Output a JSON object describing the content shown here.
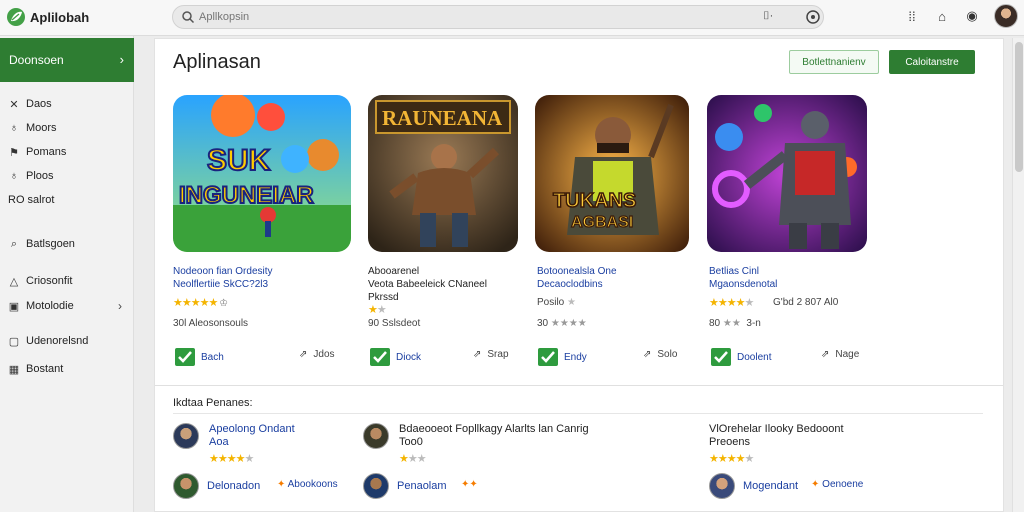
{
  "app": {
    "name": "Aplilobah"
  },
  "search": {
    "placeholder": "Apllkopsin"
  },
  "sidebar": {
    "active": "Doonsoen",
    "items": [
      {
        "label": "Daos",
        "icon": "x-icon"
      },
      {
        "label": "Moors",
        "icon": "pin-icon"
      },
      {
        "label": "Pomans",
        "icon": "flag-icon"
      },
      {
        "label": "Ploos",
        "icon": "pin-icon"
      },
      {
        "label": "RO salrot",
        "icon": ""
      },
      {
        "label": "Batlsgoen",
        "icon": "search-icon"
      },
      {
        "label": "Criosonfit",
        "icon": "triangle-icon"
      },
      {
        "label": "Motolodie",
        "icon": "box-icon"
      },
      {
        "label": "Udenorelsnd",
        "icon": "square-icon"
      },
      {
        "label": "Bostant",
        "icon": "grid-icon"
      }
    ]
  },
  "main": {
    "title": "Aplinasan",
    "btn_outline": "Botlettnanienv",
    "btn_solid": "Caloitanstre"
  },
  "cards": [
    {
      "thumb_text_1": "SUK",
      "thumb_text_2": "INGUNEIAR",
      "title_1": "Nodeoon fian Ordesity",
      "title_2": "Neolflertiie SkCC?2l3",
      "stars": 4.5,
      "meta": "30l Aleosonsouls",
      "action_a": "Bach",
      "action_b": "Jdos"
    },
    {
      "thumb_text_1": "RAUNEANA",
      "thumb_text_2": "",
      "title_1": "Abooarenel",
      "title_2": "Veota Babeeleick CNaneel",
      "title_3": "Pkrssd",
      "stars": 2,
      "meta": "90 Sslsdeot",
      "action_a": "Diock",
      "action_b": "Srap"
    },
    {
      "thumb_text_1": "TUKANS",
      "thumb_text_2": "AGBASI",
      "title_1": "Botoonealsla One",
      "title_2": "Decaoclodbins",
      "title_3": "Posilo",
      "stars": 0,
      "meta": "30",
      "meta_stars": 3,
      "action_a": "Endy",
      "action_b": "Solo"
    },
    {
      "thumb_text_1": "",
      "thumb_text_2": "",
      "title_1": "Betlias Cinl",
      "title_2": "Mgaonsdenotal",
      "stars": 4,
      "meta_right": "G'bd 2 807 Al0",
      "meta": "80",
      "meta_stars": 2,
      "meta_suffix": "3-n",
      "action_a": "Doolent",
      "action_b": "Nage"
    }
  ],
  "reviews": {
    "section_title": "Ikdtaa Penanes:",
    "rows": [
      {
        "name": "Apeolong Ondant",
        "sub": "Aoa",
        "stars": 4
      },
      {
        "name": "Bdaeooeot Fopllkagy Alarlts lan Canrig",
        "sub": "Too0",
        "stars": 1
      },
      {
        "name": "VlOrehelar Ilooky Bedooont",
        "sub": "Preoens",
        "stars": 4
      },
      {
        "name": "Delonadon",
        "tag": "Abookoons"
      },
      {
        "name": "Penaolam",
        "tag": ""
      },
      {
        "name": "Mogendant",
        "tag": "Oenoene"
      }
    ]
  },
  "colors": {
    "brand_green": "#2e7d32",
    "link_blue": "#1a3ea0",
    "star": "#f4b400"
  }
}
